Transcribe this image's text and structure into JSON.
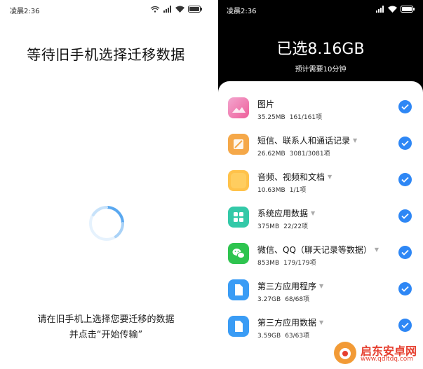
{
  "left": {
    "status_time": "凌晨2:36",
    "title": "等待旧手机选择迁移数据",
    "hint_line1": "请在旧手机上选择您要迁移的数据",
    "hint_line2": "并点击“开始传输”"
  },
  "right": {
    "status_time": "凌晨2:36",
    "selected_total": "已选8.16GB",
    "estimate": "预计需要10分钟",
    "items": [
      {
        "label": "图片",
        "size": "35.25MB",
        "count": "161/161项",
        "icon": "gallery-icon",
        "color": "#f06fa4",
        "has_caret": false
      },
      {
        "label": "短信、联系人和通话记录",
        "size": "26.62MB",
        "count": "3081/3081项",
        "icon": "messages-icon",
        "color": "#f5a849",
        "has_caret": true
      },
      {
        "label": "音频、视频和文档",
        "size": "10.63MB",
        "count": "1/1项",
        "icon": "folder-icon",
        "color": "#ffc24a",
        "has_caret": true
      },
      {
        "label": "系统应用数据",
        "size": "375MB",
        "count": "22/22项",
        "icon": "apps-grid-icon",
        "color": "#33c9a8",
        "has_caret": true
      },
      {
        "label": "微信、QQ（聊天记录等数据）",
        "size": "853MB",
        "count": "179/179项",
        "icon": "wechat-icon",
        "color": "#2ec44f",
        "has_caret": true
      },
      {
        "label": "第三方应用程序",
        "size": "3.27GB",
        "count": "68/68项",
        "icon": "file-icon",
        "color": "#3a9cf5",
        "has_caret": true
      },
      {
        "label": "第三方应用数据",
        "size": "3.59GB",
        "count": "63/63项",
        "icon": "file-icon",
        "color": "#3a9cf5",
        "has_caret": true
      }
    ]
  },
  "watermark": {
    "name": "启东安卓网",
    "url": "www.qdltdq.com"
  },
  "colors": {
    "check_blue": "#2e87f5",
    "spinner": "#5aa8f0"
  }
}
